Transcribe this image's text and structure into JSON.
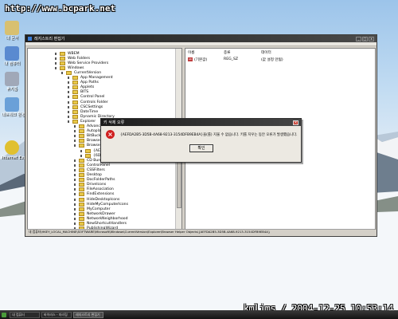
{
  "watermark": "http://www.bcpark.net",
  "stamp": "kmlims / 2004-12-25 10:53:14",
  "desktop_icons": [
    {
      "label": "내 문서",
      "color": "#d8c070"
    },
    {
      "label": "내 컴퓨터",
      "color": "#5a8ad0"
    },
    {
      "label": "휴지통",
      "color": "#a0a8b8"
    },
    {
      "label": "네트워크 환경",
      "color": "#6aa0d8"
    },
    {
      "label": "Internet Explorer",
      "color": "#e0c030"
    }
  ],
  "explorer": {
    "title": "레지스트리 편집기",
    "tree": [
      "WBEM",
      "Web Folders",
      "Web Service Providers",
      "Windows",
      "CurrentVersion",
      "App Management",
      "App Paths",
      "Applets",
      "BITS",
      "Control Panel",
      "Controls Folder",
      "CSCSettings",
      "DateTime",
      "Dynamic Directory",
      "Explorer",
      "Advanced",
      "AutoplayHandlers",
      "BitBucket",
      "BrowseNewProcess",
      "Browser Helper Objects",
      "{AEFDA2B5-3D5B-4A68-9213-3154DFB9EB4A}",
      "{6D5F51F5-1A38-4FE4-A70A-4E8F4C0B8D4E}",
      "CD Burning",
      "ControlPanel",
      "CSSFilters",
      "Desktop",
      "DocFolderPaths",
      "DriveIcons",
      "FileAssociation",
      "FindExtensions",
      "HideDesktopIcons",
      "HideMyComputerIcons",
      "MyComputer",
      "NetworkDrawer",
      "NetworkNeighborhood",
      "NewShortcutHandlers",
      "PublishingWizard"
    ],
    "list_headers": {
      "name": "이름",
      "type": "종류",
      "data": "데이터"
    },
    "list_row": {
      "name": "(기본값)",
      "type": "REG_SZ",
      "data": "(값 설정 안됨)"
    },
    "status": "내 컴퓨터\\HKEY_LOCAL_MACHINE\\SOFTWARE\\Microsoft\\Windows\\CurrentVersion\\Explorer\\Browser Helper Objects\\{AEFDA2B5-3D5B-4A68-9213-3154DFB9EB4A}"
  },
  "dialog": {
    "title": "키 삭제 오류",
    "message": "{AEFDA2B5-3D5B-4A68-9213-3154DFB9EB4A}을(를) 지울 수 없습니다. 키를 지우는 동안 오류가 발생했습니다.",
    "ok_label": "확인"
  },
  "taskbar": {
    "items": [
      "내 컴퓨터",
      "바이러스 - 미러링",
      "레지스트리 편집기"
    ]
  }
}
